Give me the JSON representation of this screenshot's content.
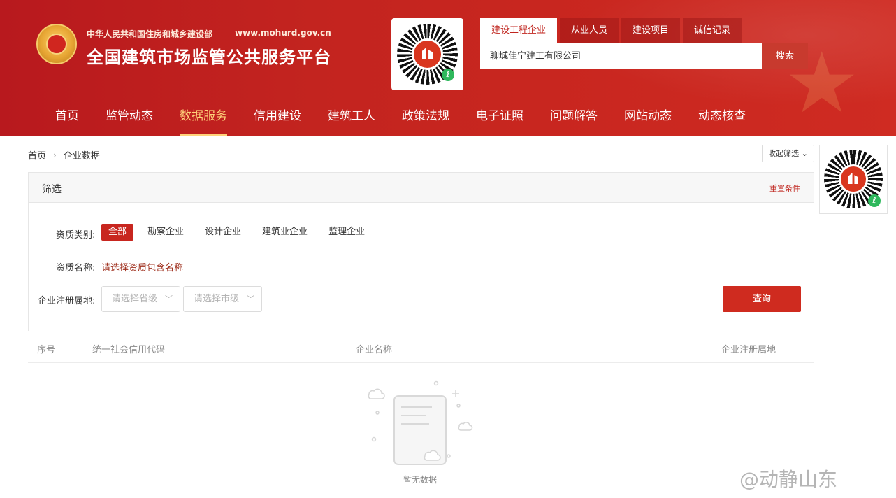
{
  "header": {
    "ministry": "中华人民共和国住房和城乡建设部",
    "url": "www.mohurd.gov.cn",
    "title": "全国建筑市场监管公共服务平台"
  },
  "search": {
    "tabs": [
      "建设工程企业",
      "从业人员",
      "建设项目",
      "诚信记录"
    ],
    "active_tab": 0,
    "value": "聊城佳宁建工有限公司",
    "button": "搜索"
  },
  "nav": {
    "items": [
      "首页",
      "监管动态",
      "数据服务",
      "信用建设",
      "建筑工人",
      "政策法规",
      "电子证照",
      "问题解答",
      "网站动态",
      "动态核查"
    ],
    "active": 2
  },
  "breadcrumb": {
    "home": "首页",
    "current": "企业数据"
  },
  "collapse_button": "收起筛选",
  "filter": {
    "title": "筛选",
    "reset": "重置条件",
    "qual_type_label": "资质类别:",
    "qual_types": [
      "全部",
      "勘察企业",
      "设计企业",
      "建筑业企业",
      "监理企业"
    ],
    "qual_type_active": 0,
    "qual_name_label": "资质名称:",
    "qual_name_link": "请选择资质包含名称",
    "region_label": "企业注册属地:",
    "province_placeholder": "请选择省级",
    "city_placeholder": "请选择市级",
    "query_button": "查询"
  },
  "table": {
    "columns": [
      "序号",
      "统一社会信用代码",
      "企业名称",
      "企业注册属地"
    ]
  },
  "empty_text": "暂无数据",
  "watermark": "@动静山东",
  "colors": {
    "brand_red": "#c8261f",
    "nav_active": "#ffd27a",
    "link_red": "#a0311f"
  }
}
